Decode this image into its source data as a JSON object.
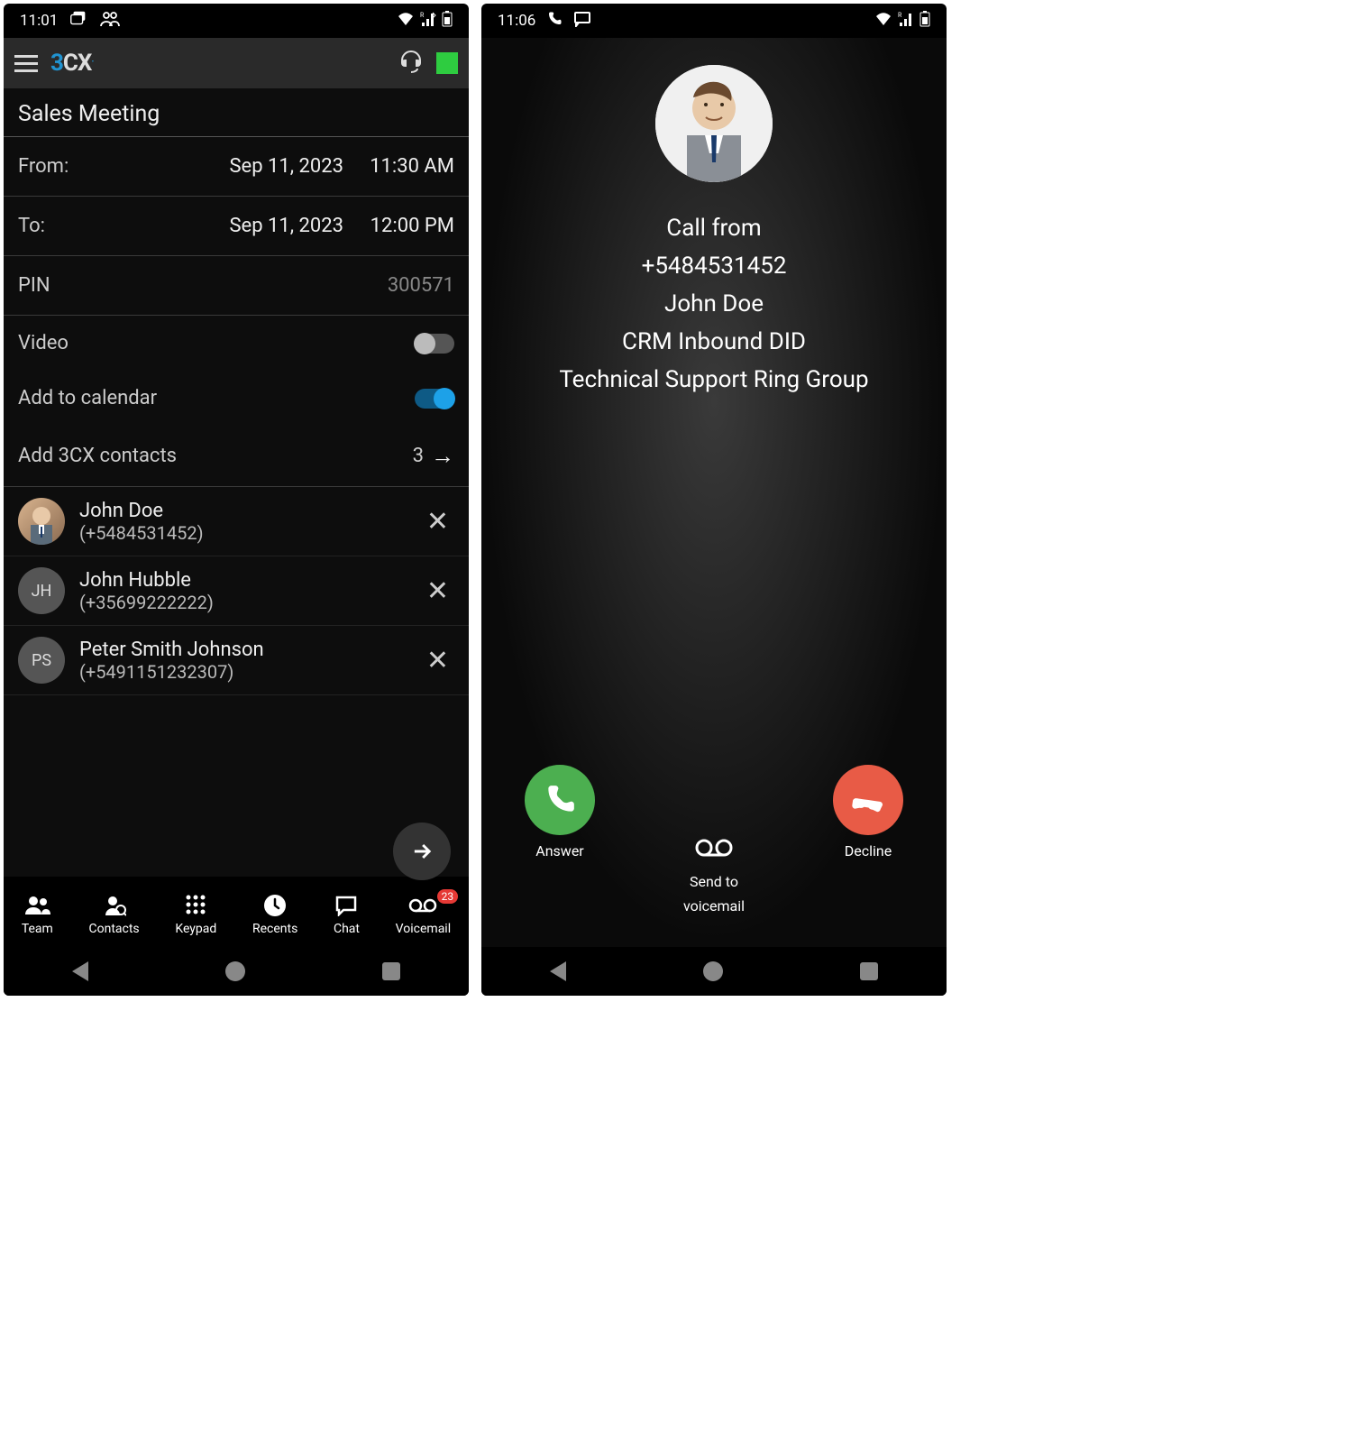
{
  "left": {
    "status_time": "11:01",
    "meeting_title": "Sales Meeting",
    "from_label": "From:",
    "from_date": "Sep 11, 2023",
    "from_time": "11:30 AM",
    "to_label": "To:",
    "to_date": "Sep 11, 2023",
    "to_time": "12:00 PM",
    "pin_label": "PIN",
    "pin_value": "300571",
    "video_label": "Video",
    "calendar_label": "Add to calendar",
    "contacts_label": "Add 3CX contacts",
    "contacts_count": "3",
    "contacts": [
      {
        "name": "John Doe",
        "number": "(+5484531452)",
        "initials": "",
        "photo": true
      },
      {
        "name": "John Hubble",
        "number": "(+35699222222)",
        "initials": "JH",
        "photo": false
      },
      {
        "name": "Peter Smith Johnson",
        "number": "(+5491151232307)",
        "initials": "PS",
        "photo": false
      }
    ],
    "nav": {
      "team": "Team",
      "contacts": "Contacts",
      "keypad": "Keypad",
      "recents": "Recents",
      "chat": "Chat",
      "voicemail": "Voicemail",
      "vm_badge": "23"
    }
  },
  "right": {
    "status_time": "11:06",
    "call_from_label": "Call from",
    "caller_number": "+5484531452",
    "caller_name": "John Doe",
    "did_line1": "CRM Inbound DID",
    "did_line2": "Technical Support Ring Group",
    "answer_label": "Answer",
    "decline_label": "Decline",
    "vm_label_1": "Send to",
    "vm_label_2": "voicemail"
  }
}
